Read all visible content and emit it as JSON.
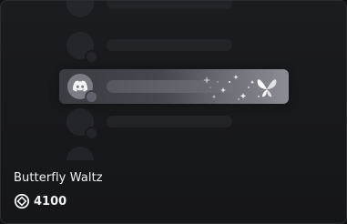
{
  "item": {
    "name": "Butterfly Waltz",
    "price": "4100",
    "currency_icon": "orb-icon"
  },
  "colors": {
    "background": "#111214",
    "card": "#1b1c20",
    "text": "#f2f3f5",
    "highlight": "#8c8d95"
  }
}
